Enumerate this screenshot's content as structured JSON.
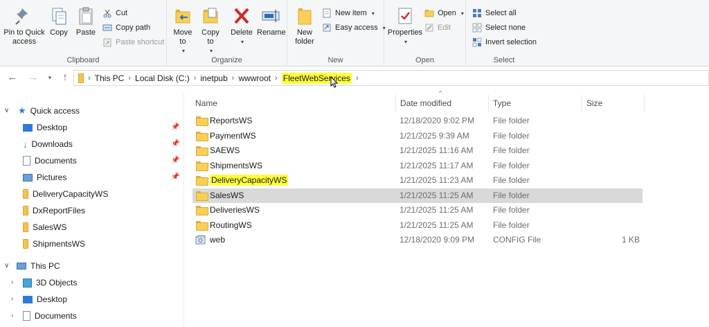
{
  "ribbon": {
    "clipboard": {
      "label": "Clipboard",
      "pin": "Pin to Quick access",
      "copy": "Copy",
      "paste": "Paste",
      "cut": "Cut",
      "copy_path": "Copy path",
      "paste_shortcut": "Paste shortcut"
    },
    "organize": {
      "label": "Organize",
      "move_to": "Move to",
      "copy_to": "Copy to",
      "delete": "Delete",
      "rename": "Rename"
    },
    "new": {
      "label": "New",
      "new_folder": "New folder",
      "new_item": "New item",
      "easy_access": "Easy access"
    },
    "open": {
      "label": "Open",
      "properties": "Properties",
      "open": "Open",
      "edit": "Edit"
    },
    "select": {
      "label": "Select",
      "select_all": "Select all",
      "select_none": "Select none",
      "invert": "Invert selection"
    }
  },
  "address": {
    "crumbs": [
      "This PC",
      "Local Disk (C:)",
      "inetpub",
      "wwwroot",
      "FleetWebServices"
    ]
  },
  "sidebar": {
    "quick_access": "Quick access",
    "quick_items": [
      "Desktop",
      "Downloads",
      "Documents",
      "Pictures",
      "DeliveryCapacityWS",
      "DxReportFiles",
      "SalesWS",
      "ShipmentsWS"
    ],
    "this_pc": "This PC",
    "pc_items": [
      "3D Objects",
      "Desktop",
      "Documents"
    ]
  },
  "columns": {
    "name": "Name",
    "date": "Date modified",
    "type": "Type",
    "size": "Size"
  },
  "files": [
    {
      "name": "ReportsWS",
      "date": "12/18/2020 9:02 PM",
      "type": "File folder",
      "size": ""
    },
    {
      "name": "PaymentWS",
      "date": "1/21/2025 9:39 AM",
      "type": "File folder",
      "size": ""
    },
    {
      "name": "SAEWS",
      "date": "1/21/2025 11:16 AM",
      "type": "File folder",
      "size": ""
    },
    {
      "name": "ShipmentsWS",
      "date": "1/21/2025 11:17 AM",
      "type": "File folder",
      "size": ""
    },
    {
      "name": "DeliveryCapacityWS",
      "date": "1/21/2025 11:23 AM",
      "type": "File folder",
      "size": ""
    },
    {
      "name": "SalesWS",
      "date": "1/21/2025 11:25 AM",
      "type": "File folder",
      "size": ""
    },
    {
      "name": "DeliveriesWS",
      "date": "1/21/2025 11:25 AM",
      "type": "File folder",
      "size": ""
    },
    {
      "name": "RoutingWS",
      "date": "1/21/2025 11:25 AM",
      "type": "File folder",
      "size": ""
    },
    {
      "name": "web",
      "date": "12/18/2020 9:09 PM",
      "type": "CONFIG File",
      "size": "1 KB"
    }
  ],
  "colors": {
    "highlight": "#ffff3a",
    "selected_row": "#d9d9d9",
    "folder": "#f8cf57",
    "quick_access_star": "#2f7ad4"
  }
}
